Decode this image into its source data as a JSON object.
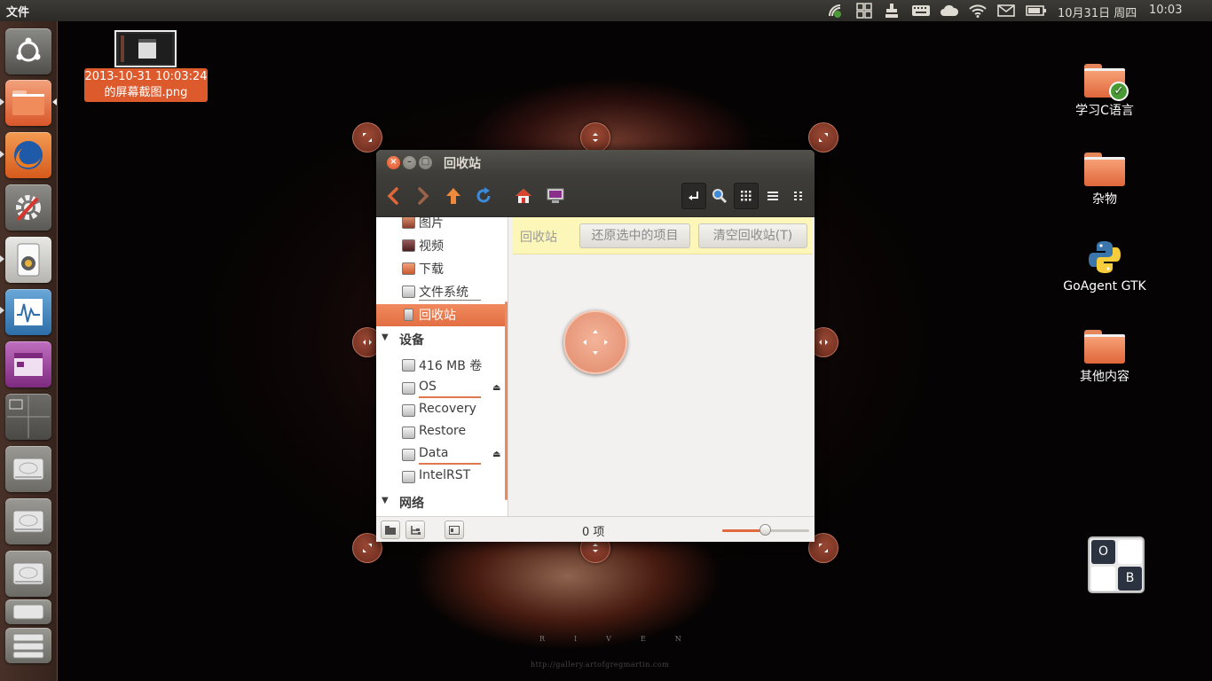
{
  "top_panel": {
    "app_menu": "文件",
    "clock_date": "10月31日 周四",
    "clock_time": "10:03",
    "tray_icons": [
      "network-manager-icon",
      "workspaces-icon",
      "keyboard-layout-icon",
      "keyboard-icon",
      "cloud-icon",
      "wifi-icon",
      "mail-icon",
      "battery-icon"
    ]
  },
  "launcher": {
    "items": [
      "ubuntu-dash-icon",
      "files-icon",
      "firefox-icon",
      "system-settings-icon",
      "rhythmbox-icon",
      "system-monitor-icon",
      "purple-app-icon",
      "workspace-switcher-icon",
      "drive-icon",
      "drive-icon",
      "drive-icon",
      "drive-icon",
      "drive-icon"
    ]
  },
  "desktop": {
    "screenshot_label_line1": "2013-10-31 10:03:24",
    "screenshot_label_line2": "的屏幕截图.png",
    "icons": [
      {
        "label": "学习C语言",
        "type": "folder-checked"
      },
      {
        "label": "杂物",
        "type": "folder"
      },
      {
        "label": "GoAgent GTK",
        "type": "python"
      },
      {
        "label": "其他内容",
        "type": "folder"
      }
    ]
  },
  "window": {
    "title": "回收站",
    "sidebar": {
      "places": [
        {
          "label": "图片"
        },
        {
          "label": "视频"
        },
        {
          "label": "下载"
        },
        {
          "label": "文件系统"
        },
        {
          "label": "回收站",
          "selected": true
        }
      ],
      "devices_header": "设备",
      "devices": [
        {
          "label": "416 MB 卷"
        },
        {
          "label": "OS",
          "eject": "⏏"
        },
        {
          "label": "Recovery"
        },
        {
          "label": "Restore"
        },
        {
          "label": "Data",
          "eject": "⏏"
        },
        {
          "label": "IntelRST"
        }
      ],
      "network_header": "网络"
    },
    "infobar": {
      "title": "回收站",
      "restore_button": "还原选中的项目",
      "empty_button": "清空回收站(T)"
    },
    "status": {
      "item_count": "0 项",
      "zoom_fraction": 0.5
    }
  },
  "ob_widget": {
    "cell_o": "O",
    "cell_b": "B"
  },
  "wallpaper": {
    "text": "RIVEN",
    "url_text": "http://gallery.artofgregmartin.com"
  },
  "colors": {
    "accent": "#e0663a",
    "panel": "#3c3b37"
  }
}
